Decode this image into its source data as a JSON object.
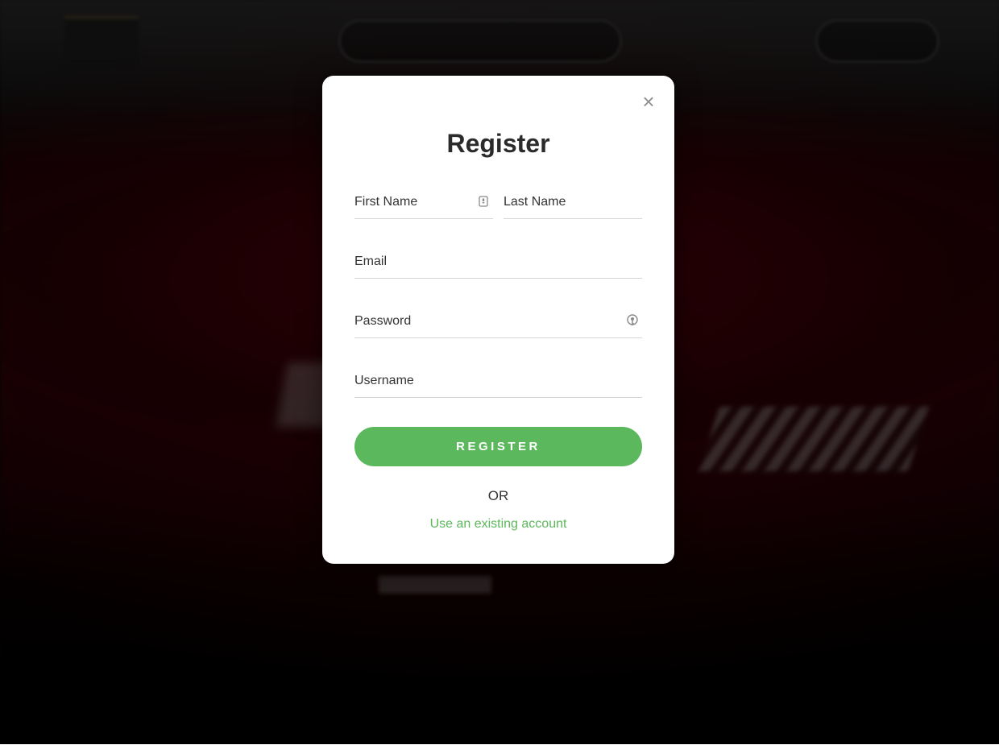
{
  "modal": {
    "title": "Register",
    "close_glyph": "×",
    "fields": {
      "first_name": {
        "placeholder": "First Name",
        "value": "",
        "icon": "contact-card-icon"
      },
      "last_name": {
        "placeholder": "Last Name",
        "value": ""
      },
      "email": {
        "placeholder": "Email",
        "value": ""
      },
      "password": {
        "placeholder": "Password",
        "value": "",
        "icon": "password-key-icon"
      },
      "username": {
        "placeholder": "Username",
        "value": ""
      }
    },
    "register_label": "REGISTER",
    "or_label": "OR",
    "existing_account_link": "Use an existing account"
  },
  "colors": {
    "accent": "#5cb85c",
    "overlay": "rgba(0,0,0,0.55)",
    "title": "#2b2b2b"
  }
}
